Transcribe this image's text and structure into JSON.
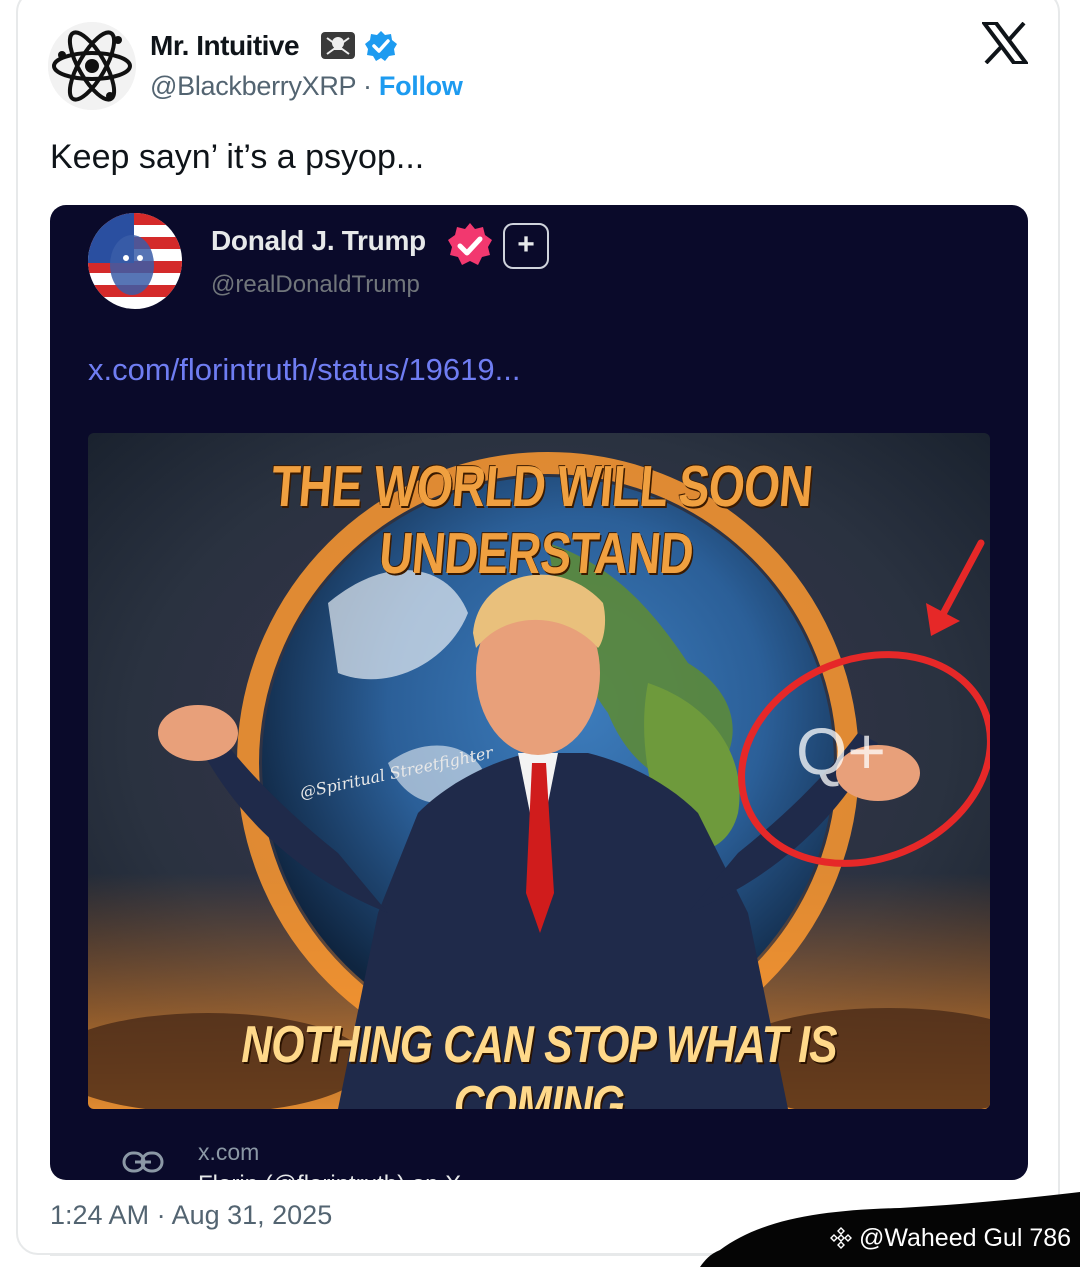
{
  "author": {
    "display_name": "Mr. Intuitive",
    "handle": "@BlackberryXRP",
    "separator": " · ",
    "follow_label": "Follow"
  },
  "tweet": {
    "text": "Keep sayn’ it’s a psyop...",
    "timestamp": "1:24 AM · Aug 31, 2025"
  },
  "embedded_post": {
    "display_name": "Donald J. Trump",
    "handle": "@realDonaldTrump",
    "plus_label": "+",
    "link": "x.com/florintruth/status/19619...",
    "image": {
      "top_caption": "THE WORLD WILL SOON UNDERSTAND",
      "bottom_caption": "NOTHING CAN STOP WHAT IS COMING",
      "watermark": "@Spiritual Streetfighter",
      "symbol": "Q+"
    },
    "link_card": {
      "domain": "x.com",
      "title": "Florin (@florintruth) on X"
    }
  },
  "overlay": {
    "watermark": "@Waheed Gul 786"
  },
  "icons": {
    "x_logo": "x-logo-icon",
    "verified": "verified-badge-icon",
    "link": "link-icon"
  },
  "colors": {
    "follow_blue": "#1d9bf0",
    "embed_bg": "#0a0a2a",
    "link_purple": "#6f7df2",
    "verified_pink": "#f2386f",
    "annotation_red": "#e62828"
  }
}
